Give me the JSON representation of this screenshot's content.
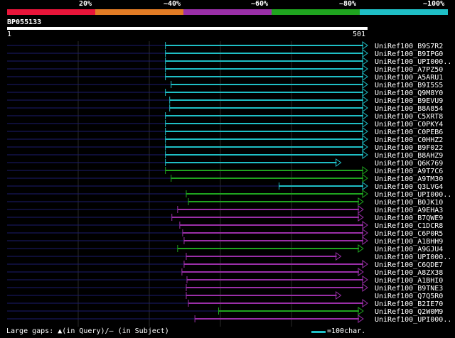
{
  "legend": {
    "labels": [
      "20%",
      "~40%",
      "~60%",
      "~80%",
      "~100%"
    ],
    "colors": [
      "#e8153a",
      "#e27c25",
      "#9a2fa8",
      "#1fa41f",
      "#1fbfc6"
    ]
  },
  "query": {
    "id": "BP055133",
    "start": "1",
    "end": "501",
    "length": 501
  },
  "hits": [
    {
      "name": "UniRef100_B9S7R2",
      "start": 220,
      "end": 501,
      "color": "#1fbfc6"
    },
    {
      "name": "UniRef100_B9IPG0",
      "start": 220,
      "end": 501,
      "color": "#1fbfc6"
    },
    {
      "name": "UniRef100_UPI000..",
      "start": 220,
      "end": 501,
      "color": "#1fbfc6"
    },
    {
      "name": "UniRef100_A7PZ50",
      "start": 220,
      "end": 501,
      "color": "#1fbfc6"
    },
    {
      "name": "UniRef100_A5ARU1",
      "start": 220,
      "end": 501,
      "color": "#1fbfc6"
    },
    {
      "name": "UniRef100_B9I5S5",
      "start": 228,
      "end": 501,
      "color": "#1fbfc6"
    },
    {
      "name": "UniRef100_Q9M8Y0",
      "start": 220,
      "end": 501,
      "color": "#1fbfc6"
    },
    {
      "name": "UniRef100_B9EVU9",
      "start": 226,
      "end": 501,
      "color": "#1fbfc6"
    },
    {
      "name": "UniRef100_B8A854",
      "start": 226,
      "end": 501,
      "color": "#1fbfc6"
    },
    {
      "name": "UniRef100_C5XRT8",
      "start": 220,
      "end": 501,
      "color": "#1fbfc6"
    },
    {
      "name": "UniRef100_C0PKY4",
      "start": 220,
      "end": 501,
      "color": "#1fbfc6"
    },
    {
      "name": "UniRef100_C0PEB6",
      "start": 220,
      "end": 501,
      "color": "#1fbfc6"
    },
    {
      "name": "UniRef100_C0HHZ2",
      "start": 220,
      "end": 501,
      "color": "#1fbfc6"
    },
    {
      "name": "UniRef100_B9F022",
      "start": 220,
      "end": 501,
      "color": "#1fbfc6"
    },
    {
      "name": "UniRef100_B8AHZ9",
      "start": 220,
      "end": 501,
      "color": "#1fbfc6"
    },
    {
      "name": "UniRef100_Q6K769",
      "start": 220,
      "end": 464,
      "color": "#1fbfc6"
    },
    {
      "name": "UniRef100_A9T7C6",
      "start": 220,
      "end": 501,
      "color": "#1fa41f"
    },
    {
      "name": "UniRef100_A9TM30",
      "start": 228,
      "end": 501,
      "color": "#1fa41f"
    },
    {
      "name": "UniRef100_Q3LVG4",
      "start": 378,
      "end": 501,
      "color": "#1fbfc6"
    },
    {
      "name": "UniRef100_UPI000..",
      "start": 249,
      "end": 501,
      "color": "#1fa41f"
    },
    {
      "name": "UniRef100_B0JK10",
      "start": 252,
      "end": 495,
      "color": "#1fa41f"
    },
    {
      "name": "UniRef100_A9EHA3",
      "start": 237,
      "end": 495,
      "color": "#9a2fa8"
    },
    {
      "name": "UniRef100_B7QWE9",
      "start": 229,
      "end": 495,
      "color": "#9a2fa8"
    },
    {
      "name": "UniRef100_C1DCR8",
      "start": 240,
      "end": 501,
      "color": "#9a2fa8"
    },
    {
      "name": "UniRef100_C6P0R5",
      "start": 244,
      "end": 501,
      "color": "#9a2fa8"
    },
    {
      "name": "UniRef100_A1BHH9",
      "start": 246,
      "end": 501,
      "color": "#9a2fa8"
    },
    {
      "name": "UniRef100_A9GJU4",
      "start": 237,
      "end": 495,
      "color": "#1fa41f"
    },
    {
      "name": "UniRef100_UPI000..",
      "start": 249,
      "end": 464,
      "color": "#9a2fa8"
    },
    {
      "name": "UniRef100_C6QDE7",
      "start": 246,
      "end": 501,
      "color": "#9a2fa8"
    },
    {
      "name": "UniRef100_A8ZX38",
      "start": 243,
      "end": 495,
      "color": "#9a2fa8"
    },
    {
      "name": "UniRef100_A1BHI0",
      "start": 250,
      "end": 501,
      "color": "#9a2fa8"
    },
    {
      "name": "UniRef100_B9TNE3",
      "start": 249,
      "end": 501,
      "color": "#9a2fa8"
    },
    {
      "name": "UniRef100_Q7Q5R0",
      "start": 249,
      "end": 464,
      "color": "#9a2fa8"
    },
    {
      "name": "UniRef100_B2IE70",
      "start": 252,
      "end": 501,
      "color": "#9a2fa8"
    },
    {
      "name": "UniRef100_Q2W0M9",
      "start": 294,
      "end": 495,
      "color": "#1fa41f"
    },
    {
      "name": "UniRef100_UPI000..",
      "start": 261,
      "end": 495,
      "color": "#9a2fa8"
    }
  ],
  "footer": {
    "gaps_prefix": "Large gaps: ",
    "gaps_query_symbol": "▲",
    "gaps_query": "(in Query)/",
    "gaps_subject_symbol": "–",
    "gaps_subject": " (in Subject)",
    "scale_label": "=100char.",
    "scale_color": "#1fbfc6"
  }
}
